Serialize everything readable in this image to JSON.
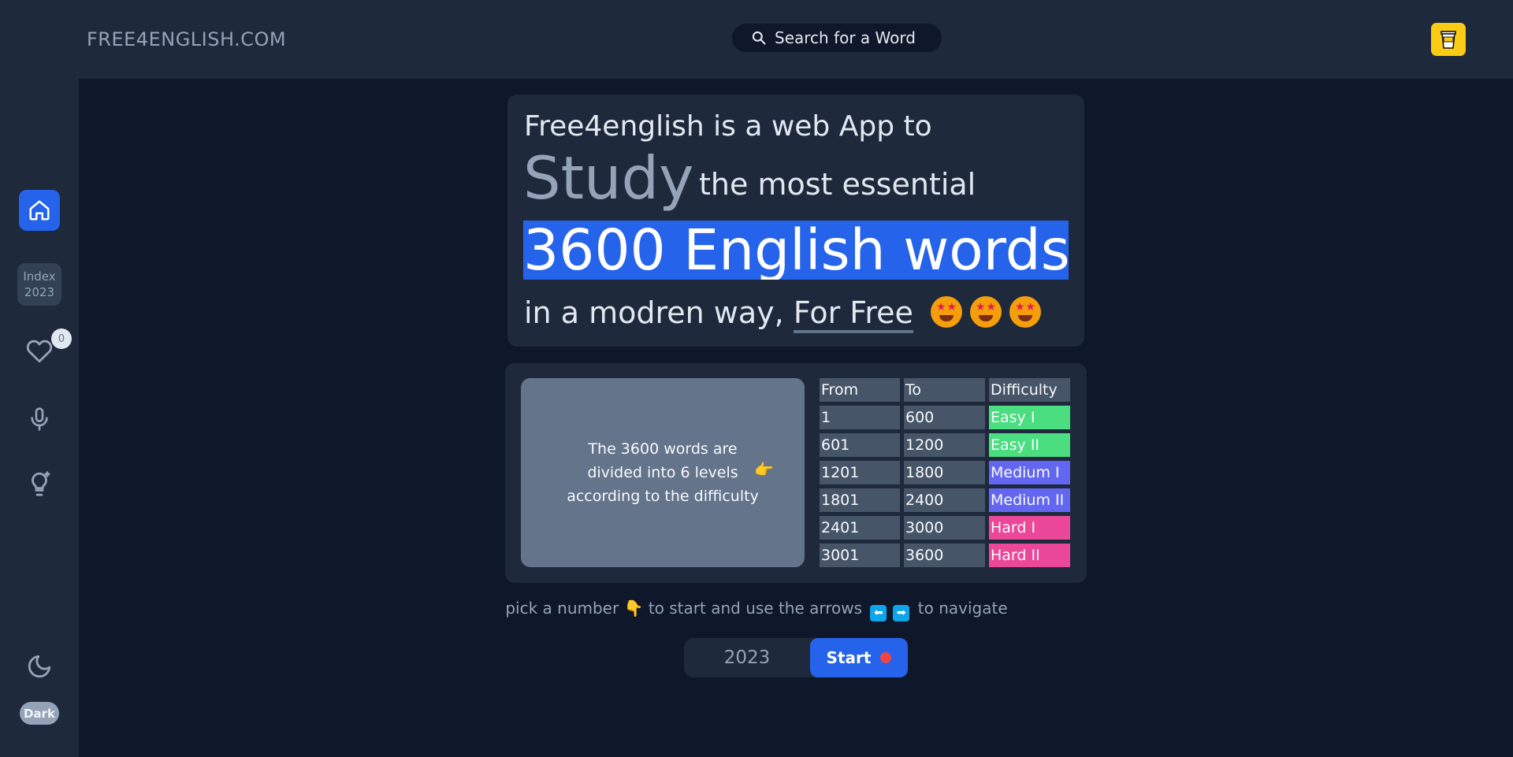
{
  "header": {
    "logo": "FREE4ENGLISH.COM",
    "search_label": "Search for a Word"
  },
  "sidebar": {
    "index_label_1": "Index",
    "index_label_2": "2023",
    "favorites_count": "0",
    "theme_label": "Dark"
  },
  "hero": {
    "line1": "Free4english is a web App to",
    "study": "Study",
    "line2": "the most essential",
    "big": "3600 English words",
    "line4_prefix": "in a modren way,",
    "for_free": "For Free"
  },
  "levels": {
    "info": "The 3600 words are divided into 6 levels according to the difficulty",
    "headers": [
      "From",
      "To",
      "Difficulty"
    ],
    "rows": [
      {
        "from": "1",
        "to": "600",
        "difficulty": "Easy I"
      },
      {
        "from": "601",
        "to": "1200",
        "difficulty": "Easy II"
      },
      {
        "from": "1201",
        "to": "1800",
        "difficulty": "Medium I"
      },
      {
        "from": "1801",
        "to": "2400",
        "difficulty": "Medium II"
      },
      {
        "from": "2401",
        "to": "3000",
        "difficulty": "Hard I"
      },
      {
        "from": "3001",
        "to": "3600",
        "difficulty": "Hard II"
      }
    ]
  },
  "bottom": {
    "hint_part1": "pick a number",
    "hint_part2": "to start and use the arrows",
    "hint_part3": "to navigate",
    "year_value": "2023",
    "start_label": "Start"
  },
  "colors": {
    "accent": "#2563eb",
    "easy": "#4ade80",
    "medium": "#6366f1",
    "hard": "#ec4899"
  }
}
